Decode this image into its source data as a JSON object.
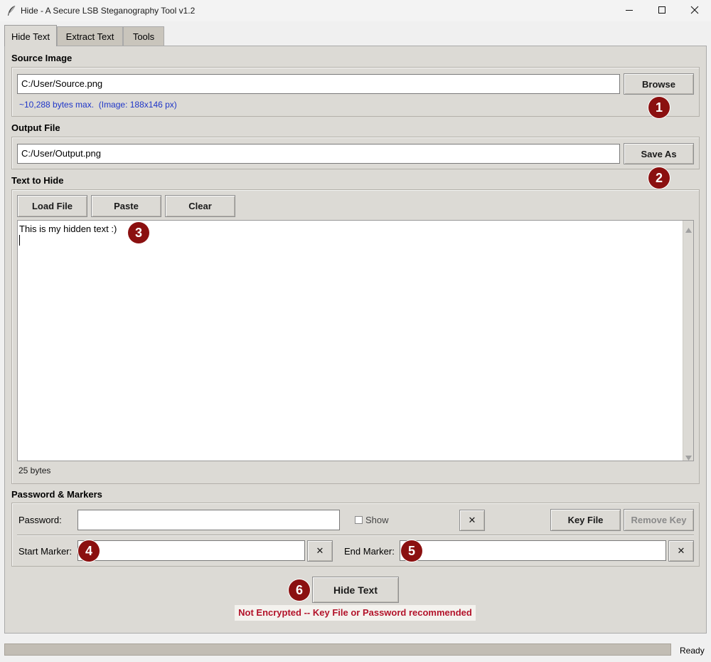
{
  "window": {
    "title": "Hide - A Secure LSB Steganography Tool v1.2"
  },
  "tabs": [
    {
      "label": "Hide Text",
      "active": true
    },
    {
      "label": "Extract Text",
      "active": false
    },
    {
      "label": "Tools",
      "active": false
    }
  ],
  "source": {
    "section_label": "Source Image",
    "path": "C:/User/Source.png",
    "browse_label": "Browse",
    "capacity_text": "~10,288 bytes max.  (Image: 188x146 px)"
  },
  "output": {
    "section_label": "Output File",
    "path": "C:/User/Output.png",
    "save_as_label": "Save As"
  },
  "text_to_hide": {
    "section_label": "Text to Hide",
    "load_file_label": "Load File",
    "paste_label": "Paste",
    "clear_label": "Clear",
    "content": "This is my hidden text :)",
    "byte_count": "25 bytes"
  },
  "password_markers": {
    "section_label": "Password & Markers",
    "password_label": "Password:",
    "password_value": "",
    "show_label": "Show",
    "show_checked": false,
    "clear_glyph": "✕",
    "key_file_label": "Key File",
    "remove_key_label": "Remove Key",
    "start_marker_label": "Start Marker:",
    "start_marker_value": "",
    "end_marker_label": "End Marker:",
    "end_marker_value": ""
  },
  "action": {
    "hide_text_label": "Hide Text",
    "warning_text": "Not Encrypted -- Key File or Password recommended"
  },
  "callouts": [
    "1",
    "2",
    "3",
    "4",
    "5",
    "6"
  ],
  "status": {
    "text": "Ready",
    "progress": 0
  },
  "colors": {
    "accent_blue": "#1f36c8",
    "warning_red": "#b3132a",
    "callout_fill": "#8b1010",
    "panel_bg": "#dcdad5"
  }
}
